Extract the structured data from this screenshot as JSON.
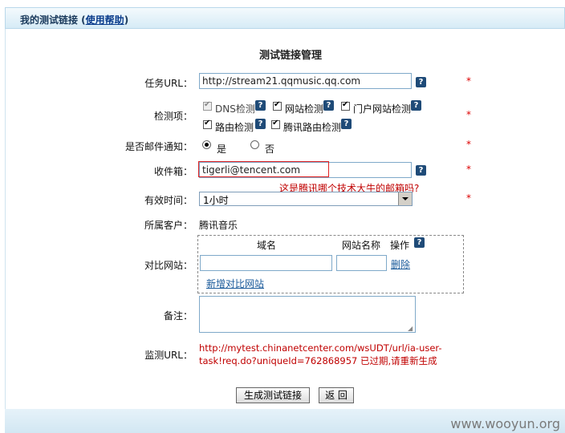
{
  "header": {
    "title_prefix": "我的测试链接 (",
    "help_link": "使用帮助",
    "title_suffix": ")"
  },
  "page_title": "测试链接管理",
  "form": {
    "task_url": {
      "label": "任务URL：",
      "value": "http://stream21.qqmusic.qq.com"
    },
    "checks": {
      "label": "检测项：",
      "items": [
        "DNS检测",
        "网站检测",
        "门户网站检测",
        "路由检测",
        "腾讯路由检测"
      ]
    },
    "email_notify": {
      "label": "是否邮件通知：",
      "yes": "是",
      "no": "否"
    },
    "recipient": {
      "label": "收件箱：",
      "value": "tigerli@tencent.com",
      "note": "这是腾讯哪个技术大牛的邮箱吗?"
    },
    "valid_time": {
      "label": "有效时间：",
      "selected": "1小时"
    },
    "customer": {
      "label": "所属客户：",
      "value": "腾讯音乐"
    },
    "compare": {
      "label": "对比网站：",
      "col_domain": "域名",
      "col_name": "网站名称",
      "col_action": "操作",
      "delete": "删除",
      "add": "新增对比网站"
    },
    "remark": {
      "label": "备注："
    },
    "monitor_url": {
      "label": "监测URL：",
      "line1": "http://mytest.chinanetcenter.com/wsUDT/url/ia-user-",
      "line2": "task!req.do?uniqueId=762868957 已过期,请重新生成"
    }
  },
  "buttons": {
    "generate": "生成测试链接",
    "back": "返 回"
  },
  "help_glyph": "?",
  "required_mark": "*",
  "watermark": "www.wooyun.org",
  "colors": {
    "accent": "#1f4b78",
    "warning": "#c00000",
    "required": "#dd0000"
  }
}
